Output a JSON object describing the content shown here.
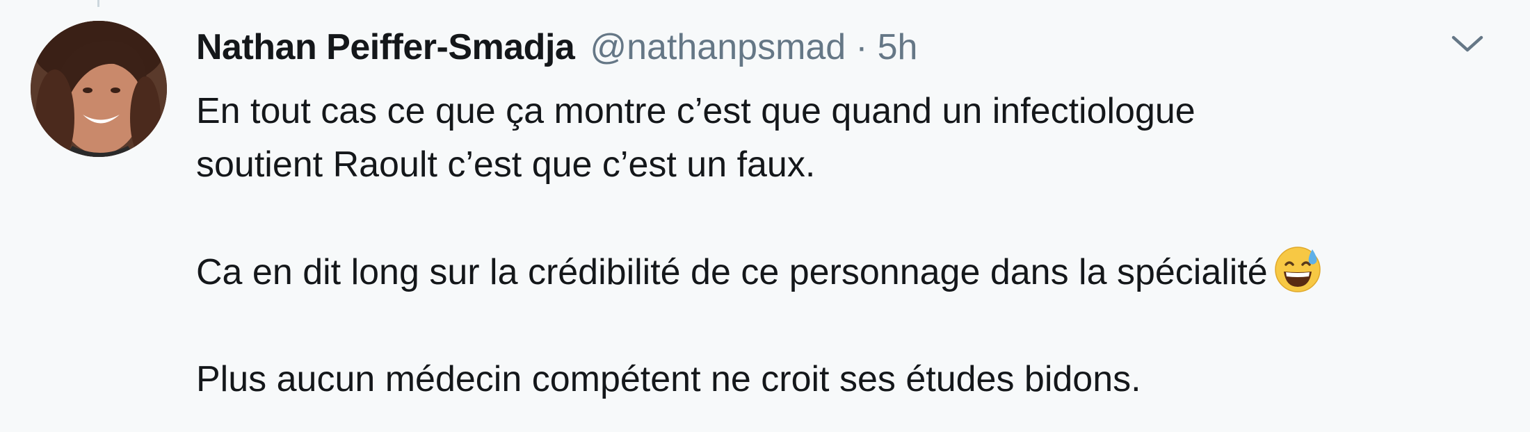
{
  "tweet": {
    "author_name": "Nathan Peiffer-Smadja",
    "handle": "@nathanpsmad",
    "separator": "·",
    "time": "5h",
    "caret_icon": "chevron-down-icon",
    "lines": [
      "En tout cas ce que ça montre c’est que quand un infectiologue",
      "soutient Raoult c’est que c’est un faux.",
      "Ca en dit long sur la crédibilité de ce personnage dans la spécialité",
      "Plus aucun médecin compétent ne croit ses études bidons."
    ],
    "emoji_icon": "grinning-sweat-emoji-icon"
  },
  "colors": {
    "background": "#f7f9fa",
    "text": "#14171a",
    "secondary": "#657786",
    "caret": "#657786"
  }
}
